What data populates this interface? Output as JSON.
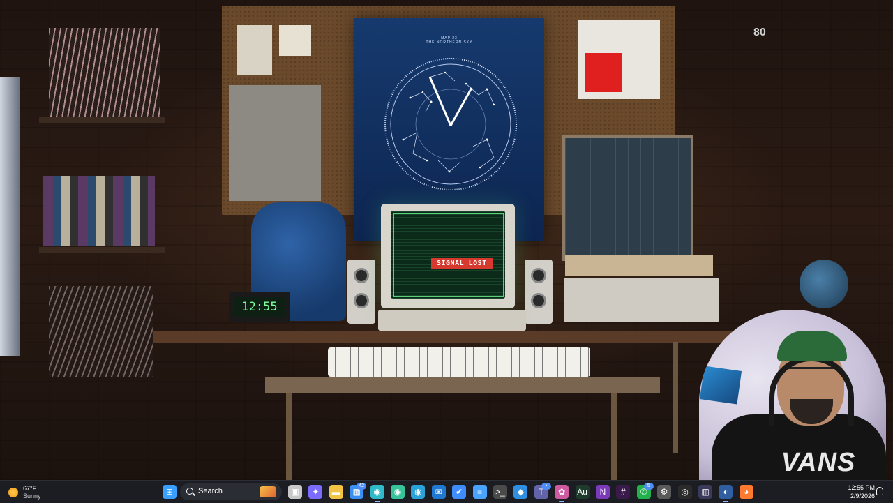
{
  "wallpaper": {
    "poster_title": "MAP 23",
    "poster_subtitle": "THE NORTHERN SKY",
    "monitor_message": "SIGNAL LOST",
    "clock_display": "12:55",
    "webcam_shirt_text": "VANS",
    "corner_number": "80"
  },
  "taskbar": {
    "weather": {
      "temp": "67°F",
      "condition": "Sunny"
    },
    "search": {
      "label": "Search"
    },
    "icons": [
      {
        "name": "start-button",
        "symbol": "⊞",
        "color": "#3aa0ff"
      },
      {
        "name": "task-view-icon",
        "symbol": "▣",
        "color": "#c8c8c8"
      },
      {
        "name": "copilot-icon",
        "symbol": "✦",
        "color": "#7b6cff"
      },
      {
        "name": "file-explorer-icon",
        "symbol": "▬",
        "color": "#f3c343"
      },
      {
        "name": "store-icon",
        "symbol": "▦",
        "color": "#3b8ff0",
        "badge": "42"
      },
      {
        "name": "edge-icon",
        "symbol": "◉",
        "color": "#2fb9c9",
        "active": true
      },
      {
        "name": "edge-beta-icon",
        "symbol": "◉",
        "color": "#37c49a"
      },
      {
        "name": "edge-dev-icon",
        "symbol": "◉",
        "color": "#2aa3d8"
      },
      {
        "name": "outlook-icon",
        "symbol": "✉",
        "color": "#1f78d1"
      },
      {
        "name": "todo-icon",
        "symbol": "✔",
        "color": "#3f8cff"
      },
      {
        "name": "notepad-icon",
        "symbol": "≡",
        "color": "#49a4ff"
      },
      {
        "name": "terminal-icon",
        "symbol": ">_",
        "color": "#4a4a4a"
      },
      {
        "name": "vscode-icon",
        "symbol": "◆",
        "color": "#2f8fe0"
      },
      {
        "name": "teams-icon",
        "symbol": "T",
        "color": "#6264a7",
        "badge": "•"
      },
      {
        "name": "app-pink-icon",
        "symbol": "✿",
        "color": "#d05aa0",
        "active": true
      },
      {
        "name": "audition-icon",
        "symbol": "Au",
        "color": "#1e3b2b"
      },
      {
        "name": "onenote-icon",
        "symbol": "N",
        "color": "#7b3bb8"
      },
      {
        "name": "slack-icon",
        "symbol": "#",
        "color": "#3a1a4a"
      },
      {
        "name": "whatsapp-icon",
        "symbol": "✆",
        "color": "#22b14c",
        "badge": "5"
      },
      {
        "name": "settings-icon",
        "symbol": "⚙",
        "color": "#5a5a5a"
      },
      {
        "name": "obs-icon",
        "symbol": "◎",
        "color": "#2b2b2b"
      },
      {
        "name": "audio-icon",
        "symbol": "▥",
        "color": "#3a3a5a"
      },
      {
        "name": "tool-icon",
        "symbol": "◐",
        "color": "#2f5fa0",
        "active": true
      },
      {
        "name": "firefox-icon",
        "symbol": "◕",
        "color": "#ff7a2e"
      }
    ],
    "clock": {
      "time": "12:55 PM",
      "date": "2/9/2026"
    }
  }
}
